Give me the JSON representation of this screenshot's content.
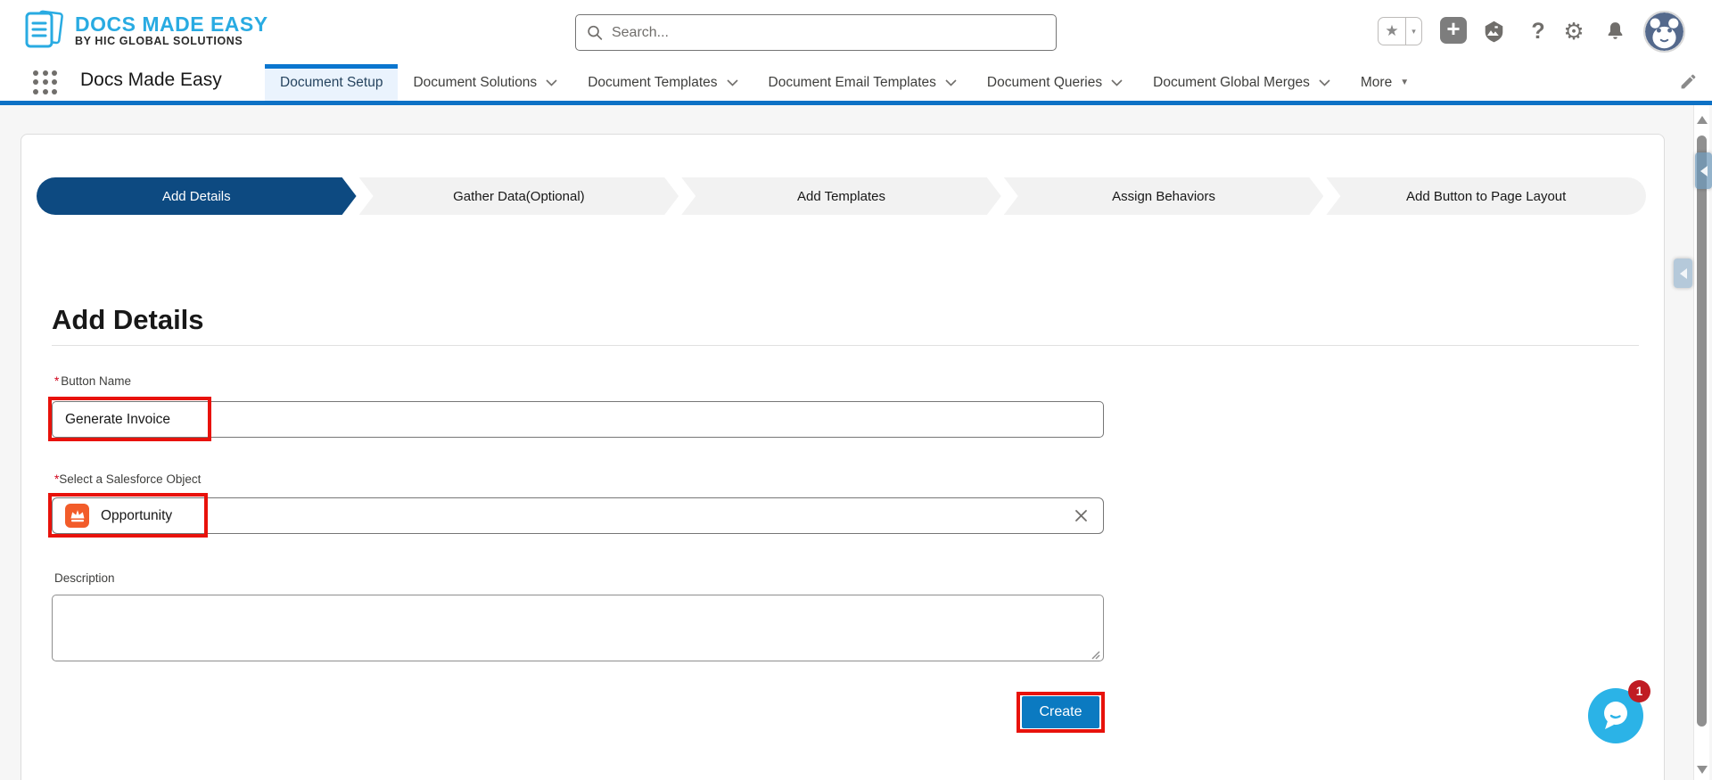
{
  "brand": {
    "title": "DOCS MADE EASY",
    "subtitle": "BY HIC GLOBAL SOLUTIONS"
  },
  "header": {
    "search_placeholder": "Search...",
    "icons": {
      "favorites_glyph": "★",
      "favorites_caret": "▾",
      "add_glyph": "+",
      "help_glyph": "?",
      "setup_glyph": "⚙",
      "more_caret": "▼"
    }
  },
  "nav": {
    "app_name": "Docs Made Easy",
    "tabs": [
      {
        "label": "Document Setup",
        "active": true
      },
      {
        "label": "Document Solutions",
        "active": false
      },
      {
        "label": "Document Templates",
        "active": false
      },
      {
        "label": "Document Email Templates",
        "active": false
      },
      {
        "label": "Document Queries",
        "active": false
      },
      {
        "label": "Document Global Merges",
        "active": false
      }
    ],
    "more_label": "More"
  },
  "path": {
    "steps": [
      {
        "label": "Add Details",
        "state": "active"
      },
      {
        "label": "Gather Data(Optional)",
        "state": "incomplete"
      },
      {
        "label": "Add Templates",
        "state": "incomplete"
      },
      {
        "label": "Assign Behaviors",
        "state": "incomplete"
      },
      {
        "label": "Add Button to Page Layout",
        "state": "incomplete"
      }
    ]
  },
  "form": {
    "heading": "Add Details",
    "fields": {
      "button_name": {
        "required_marker": "*",
        "label": "Button Name",
        "value": "Generate Invoice"
      },
      "salesforce_object": {
        "required_marker": "*",
        "label": "Select a Salesforce Object",
        "value": "Opportunity",
        "icon": "opportunity-crown-icon"
      },
      "description": {
        "label": "Description",
        "value": ""
      }
    },
    "create_button_label": "Create"
  },
  "chat_widget": {
    "badge_count": "1"
  },
  "colors": {
    "brand_blue": "#29abe2",
    "nav_active_blue": "#0b76cf",
    "divider_blue": "#0d71c5",
    "path_active_navy": "#0d4a81",
    "create_blue": "#0b7ac1",
    "annotation_red": "#e8120b",
    "opportunity_orange": "#f25c2a",
    "chat_blue": "#2bb3e7",
    "badge_red": "#c01c23"
  }
}
